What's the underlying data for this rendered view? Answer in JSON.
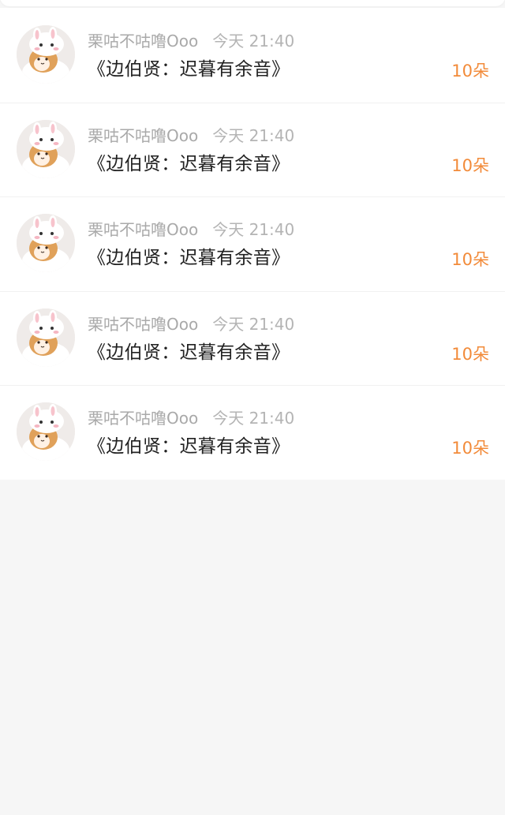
{
  "list": {
    "items": [
      {
        "user": "栗咕不咕噜Ooo",
        "time": "今天 21:40",
        "title": "《边伯贤：迟暮有余音》",
        "count": "10朵"
      },
      {
        "user": "栗咕不咕噜Ooo",
        "time": "今天 21:40",
        "title": "《边伯贤：迟暮有余音》",
        "count": "10朵"
      },
      {
        "user": "栗咕不咕噜Ooo",
        "time": "今天 21:40",
        "title": "《边伯贤：迟暮有余音》",
        "count": "10朵"
      },
      {
        "user": "栗咕不咕噜Ooo",
        "time": "今天 21:40",
        "title": "《边伯贤：迟暮有余音》",
        "count": "10朵"
      },
      {
        "user": "栗咕不咕噜Ooo",
        "time": "今天 21:40",
        "title": "《边伯贤：迟暮有余音》",
        "count": "10朵"
      }
    ]
  },
  "colors": {
    "count_accent": "#f28b3a",
    "meta_gray": "#a9a9a9",
    "background": "#f6f6f6"
  },
  "icons": {
    "avatar": "bunny-hat-cat-avatar"
  }
}
